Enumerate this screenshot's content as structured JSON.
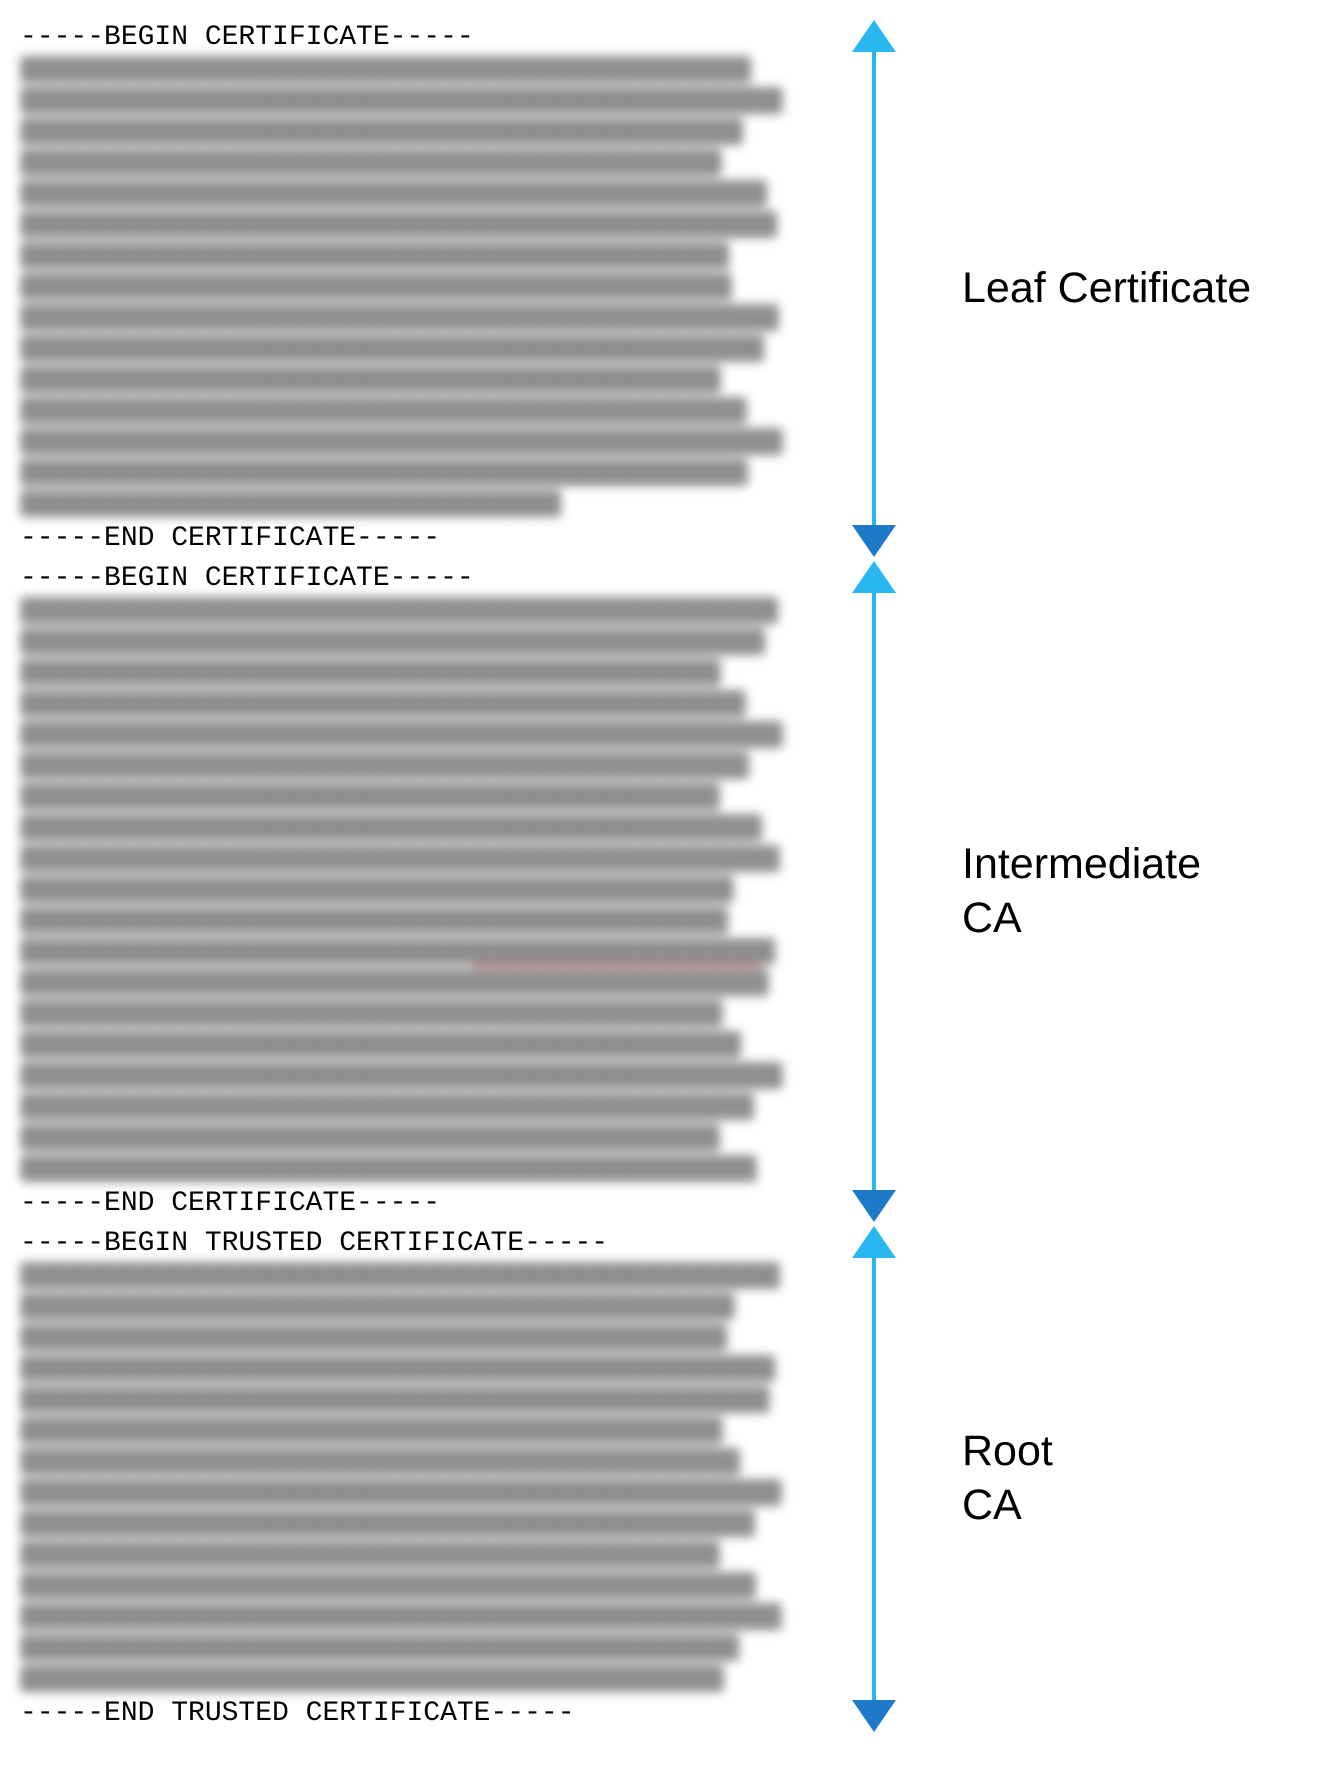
{
  "chart_data": {
    "type": "table",
    "title": "PEM certificate chain file layout",
    "entries": [
      {
        "order": 1,
        "role": "Leaf Certificate",
        "pem_header": "BEGIN CERTIFICATE",
        "pem_footer": "END CERTIFICATE",
        "body_lines": 15
      },
      {
        "order": 2,
        "role": "Intermediate CA",
        "pem_header": "BEGIN CERTIFICATE",
        "pem_footer": "END CERTIFICATE",
        "body_lines": 19
      },
      {
        "order": 3,
        "role": "Root CA",
        "pem_header": "BEGIN TRUSTED CERTIFICATE",
        "pem_footer": "END TRUSTED CERTIFICATE",
        "body_lines": 14
      }
    ]
  },
  "blocks": [
    {
      "begin": "-----BEGIN CERTIFICATE-----",
      "end": "-----END CERTIFICATE-----",
      "label": "Leaf Certificate",
      "lines": 15,
      "underline_at": -1
    },
    {
      "begin": "-----BEGIN CERTIFICATE-----",
      "end": "-----END CERTIFICATE-----",
      "label": "Intermediate\nCA",
      "lines": 19,
      "underline_at": 11
    },
    {
      "begin": "-----BEGIN TRUSTED CERTIFICATE-----",
      "end": "-----END TRUSTED CERTIFICATE-----",
      "label": "Root\nCA",
      "lines": 14,
      "underline_at": -1
    }
  ]
}
